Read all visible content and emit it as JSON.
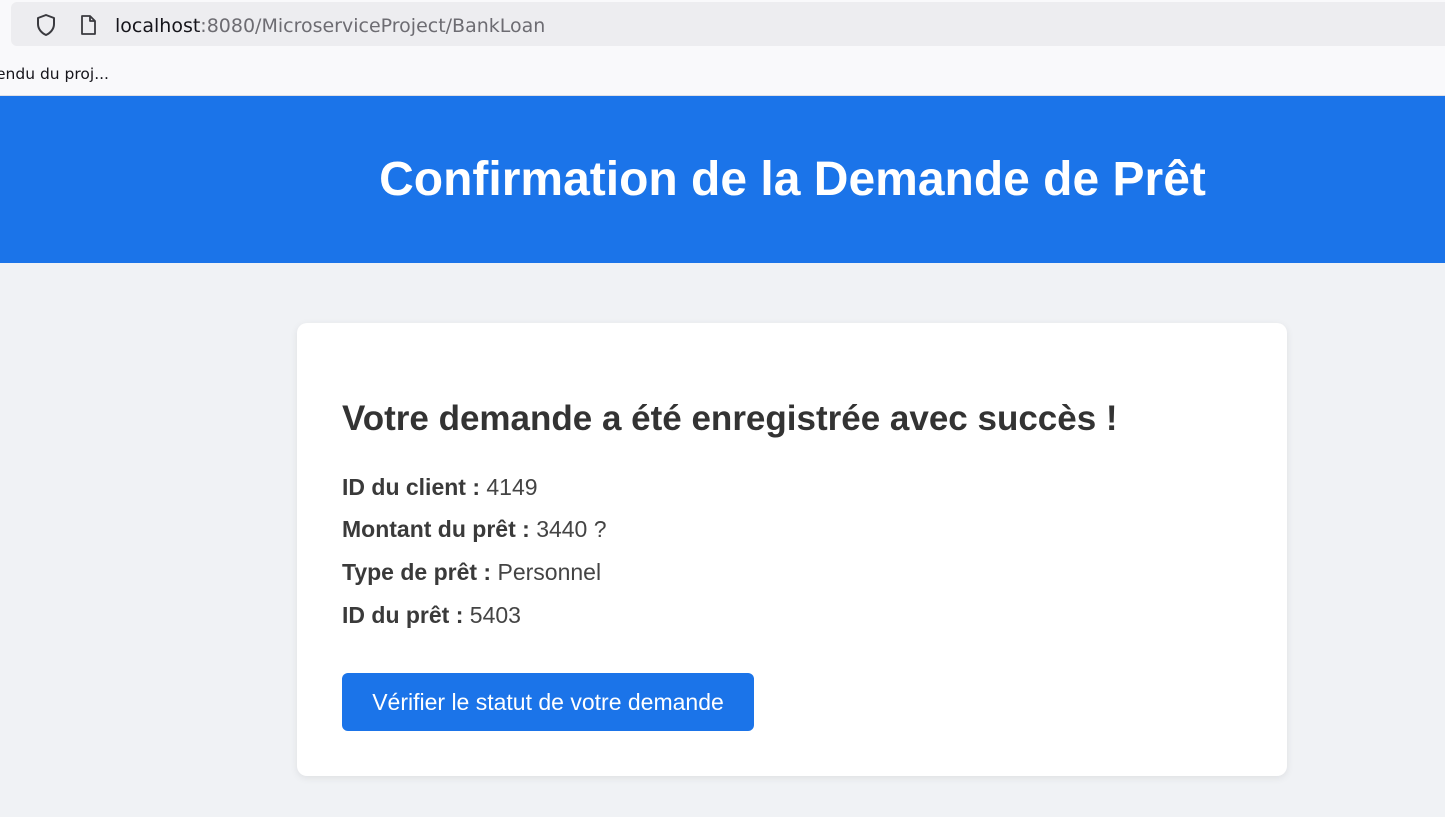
{
  "browser": {
    "url_host": "localhost",
    "url_rest": ":8080/MicroserviceProject/BankLoan",
    "bookmark": "endu du proj..."
  },
  "header": {
    "title": "Confirmation de la Demande de Prêt"
  },
  "card": {
    "heading": "Votre demande a été enregistrée avec succès !",
    "details": [
      {
        "label": "ID du client :",
        "value": "4149"
      },
      {
        "label": "Montant du prêt :",
        "value": "3440 ?"
      },
      {
        "label": "Type de prêt :",
        "value": "Personnel"
      },
      {
        "label": "ID du prêt :",
        "value": "5403"
      }
    ],
    "button_label": "Vérifier le statut de votre demande"
  },
  "colors": {
    "accent": "#1b74e9",
    "page_background": "#f0f2f5",
    "card_background": "#ffffff",
    "text_dark": "#333333"
  },
  "icons": [
    "shield-icon",
    "page-icon"
  ]
}
